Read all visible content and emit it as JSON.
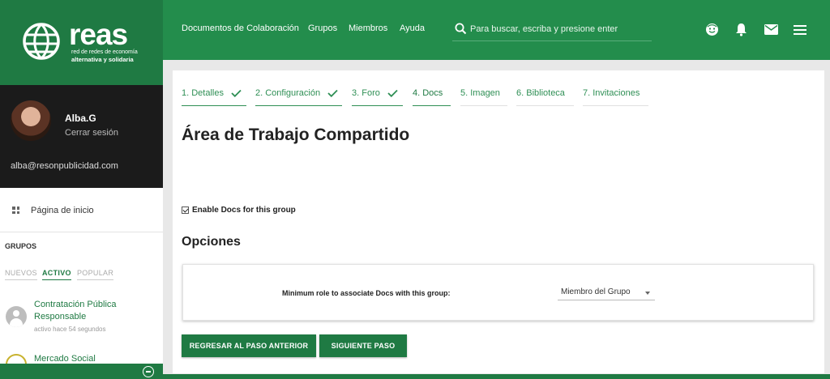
{
  "brand": {
    "name": "reas",
    "tagline_1": "red de redes de economía",
    "tagline_2": "alternativa y solidaria",
    "primary_color": "#238d4c",
    "dark_color": "#1f7a43"
  },
  "user": {
    "name": "Alba.G",
    "logout_label": "Cerrar sesión",
    "email": "alba@resonpublicidad.com"
  },
  "sidebar": {
    "home_label": "Página de inicio",
    "groups_title": "GRUPOS",
    "group_tabs": [
      "NUEVOS",
      "ACTIVO",
      "POPULAR"
    ],
    "active_tab": "ACTIVO",
    "groups": [
      {
        "title_line1": "Contratación Pública",
        "title_line2": "Responsable",
        "meta": "activo hace 54 segundos"
      },
      {
        "title_line1": "Mercado Social",
        "title_line2": "",
        "meta": ""
      }
    ]
  },
  "topbar": {
    "nav": [
      "Documentos de Colaboración",
      "Grupos",
      "Miembros",
      "Ayuda"
    ],
    "search_placeholder": "Para buscar, escriba y presione enter",
    "icons": [
      "search-icon",
      "smiley-icon",
      "bell-icon",
      "mail-icon",
      "menu-icon"
    ]
  },
  "wizard": {
    "steps": [
      {
        "label": "1. Detalles",
        "state": "done"
      },
      {
        "label": "2. Configuración",
        "state": "done"
      },
      {
        "label": "3. Foro",
        "state": "done"
      },
      {
        "label": "4. Docs",
        "state": "current"
      },
      {
        "label": "5. Imagen",
        "state": "pending"
      },
      {
        "label": "6. Biblioteca",
        "state": "pending"
      },
      {
        "label": "7. Invitaciones",
        "state": "pending"
      }
    ]
  },
  "main": {
    "title": "Área de Trabajo Compartido",
    "enable_docs_label": "Enable Docs for this group",
    "enable_docs_checked": true,
    "options_title": "Opciones",
    "role_label": "Minimum role to associate Docs with this group:",
    "role_value": "Miembro del Grupo",
    "back_button": "REGRESAR AL PASO ANTERIOR",
    "next_button": "SIGUIENTE PASO"
  }
}
